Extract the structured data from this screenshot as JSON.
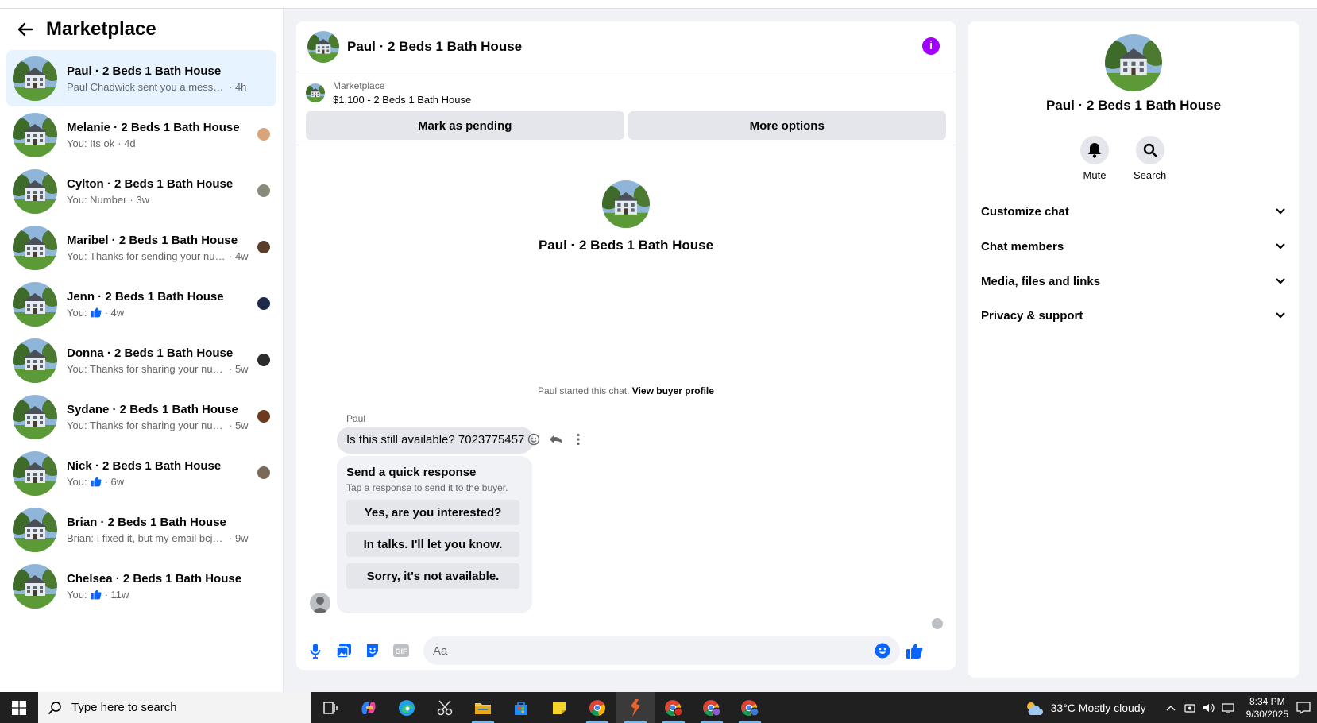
{
  "sidebar": {
    "title": "Marketplace",
    "conversations": [
      {
        "name": "Paul · 2 Beds 1 Bath House",
        "preview": "Paul Chadwick sent you a message ab...",
        "time": "· 4h",
        "active": true,
        "mini_color": ""
      },
      {
        "name": "Melanie · 2 Beds 1 Bath House",
        "preview": "You: Its ok",
        "time": "· 4d",
        "mini_color": "#d8a57a"
      },
      {
        "name": "Cylton · 2 Beds 1 Bath House",
        "preview": "You: Number",
        "time": "· 3w",
        "mini_color": "#8a8a7a"
      },
      {
        "name": "Maribel · 2 Beds 1 Bath House",
        "preview": "You: Thanks for sending your num...",
        "time": "· 4w",
        "mini_color": "#5a3d2a"
      },
      {
        "name": "Jenn · 2 Beds 1 Bath House",
        "preview": "You:",
        "time": "· 4w",
        "like": true,
        "mini_color": "#1f2a4a"
      },
      {
        "name": "Donna · 2 Beds 1 Bath House",
        "preview": "You: Thanks for sharing your num...",
        "time": "· 5w",
        "mini_color": "#2b2b2b"
      },
      {
        "name": "Sydane · 2 Beds 1 Bath House",
        "preview": "You: Thanks for sharing your num...",
        "time": "· 5w",
        "mini_color": "#6b3a1f"
      },
      {
        "name": "Nick · 2 Beds 1 Bath House",
        "preview": "You:",
        "time": "· 6w",
        "like": true,
        "mini_color": "#7a6a5a"
      },
      {
        "name": "Brian · 2 Beds 1 Bath House",
        "preview": "Brian: I fixed it, but my email bcjb20...",
        "time": "· 9w",
        "mini_color": ""
      },
      {
        "name": "Chelsea · 2 Beds 1 Bath House",
        "preview": "You:",
        "time": "· 11w",
        "like": true,
        "mini_color": ""
      }
    ]
  },
  "chat": {
    "title": "Paul · 2 Beds 1 Bath House",
    "marketplace_label": "Marketplace",
    "listing": "$1,100 - 2 Beds 1 Bath House",
    "mark_pending": "Mark as pending",
    "more_options": "More options",
    "hero_name": "Paul · 2 Beds 1 Bath House",
    "started_text": "Paul started this chat.",
    "view_profile": "View buyer profile",
    "sender": "Paul",
    "message": "Is this still available? 7023775457",
    "quick_title": "Send a quick response",
    "quick_sub": "Tap a response to send it to the buyer.",
    "quick_responses": [
      "Yes, are you interested?",
      "In talks. I'll let you know.",
      "Sorry, it's not available."
    ],
    "input_placeholder": "Aa",
    "accent": "#0866ff"
  },
  "details": {
    "name": "Paul · 2 Beds 1 Bath House",
    "mute": "Mute",
    "search": "Search",
    "sections": [
      "Customize chat",
      "Chat members",
      "Media, files and links",
      "Privacy & support"
    ]
  },
  "taskbar": {
    "search_placeholder": "Type here to search",
    "weather": "33°C  Mostly cloudy",
    "time": "8:34 PM",
    "date": "9/30/2025"
  }
}
